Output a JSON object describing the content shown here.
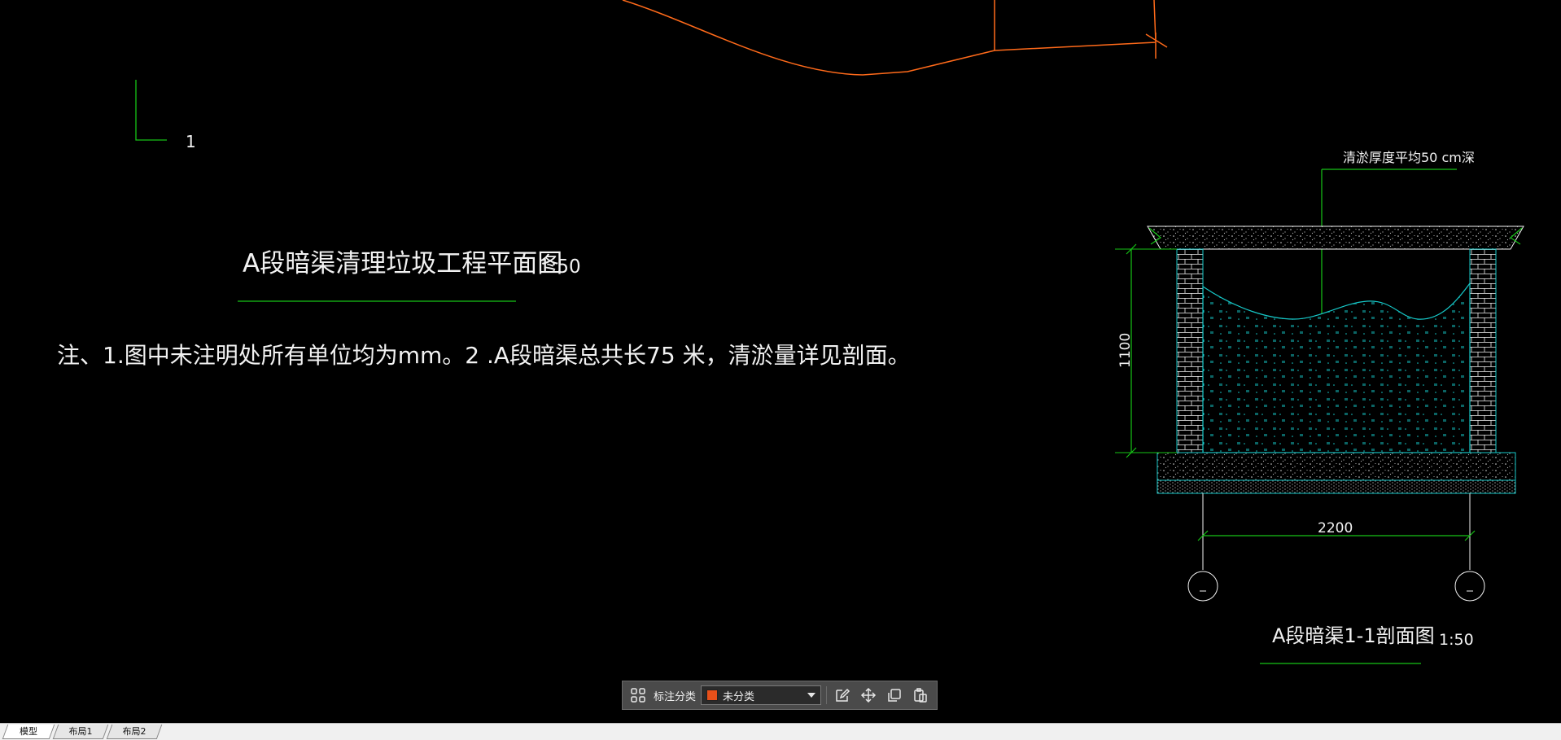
{
  "drawing": {
    "plan_title": "A段暗渠清理垃圾工程平面图",
    "plan_scale": "1:50",
    "section_marker": "1",
    "note": "注、1.图中未注明处所有单位均为mm。2 .A段暗渠总共长75 米，清淤量详见剖面。",
    "section_title": "A段暗渠1-1剖面图",
    "section_scale": "1:50",
    "annotation_leader": "清淤厚度平均50 cm深",
    "dim_height": "1100",
    "dim_width": "2200",
    "colors": {
      "background": "#000000",
      "polyline": "#ff6a1a",
      "green": "#16c316",
      "cyan": "#16c8c8",
      "white": "#f2f2f2"
    }
  },
  "annotation_toolbar": {
    "label": "标注分类",
    "selected": "未分类",
    "swatch_color": "#e8501a",
    "icons": [
      "grid-icon",
      "edit-icon",
      "move-icon",
      "copy-icon",
      "paste-icon"
    ]
  },
  "tabs": [
    {
      "label": "模型",
      "active": true
    },
    {
      "label": "布局1",
      "active": false
    },
    {
      "label": "布局2",
      "active": false
    }
  ]
}
